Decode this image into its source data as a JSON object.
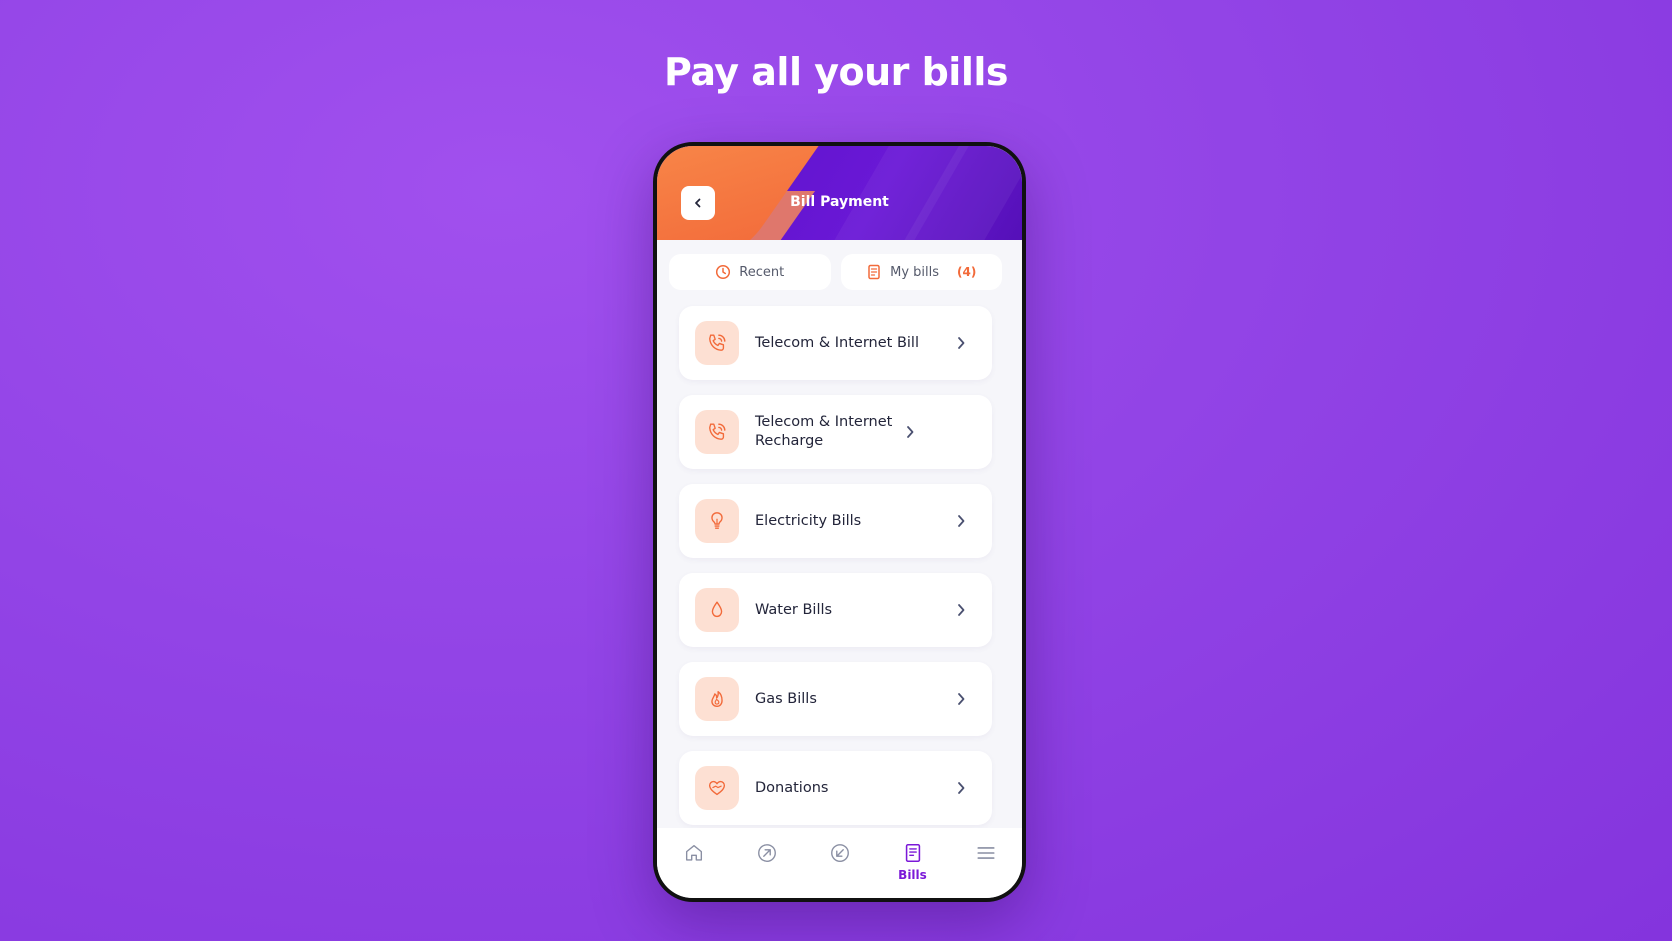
{
  "headline": "Pay all your bills",
  "header": {
    "title": "Bill Payment"
  },
  "tabs": [
    {
      "label": "Recent",
      "icon": "clock-icon"
    },
    {
      "label": "My bills",
      "count": "(4)",
      "icon": "receipt-icon"
    }
  ],
  "items": [
    {
      "label": "Telecom & Internet Bill",
      "icon": "phone-icon"
    },
    {
      "label": "Telecom & Internet Recharge",
      "icon": "phone-icon"
    },
    {
      "label": "Electricity Bills",
      "icon": "lightbulb-icon"
    },
    {
      "label": "Water Bills",
      "icon": "water-drop-icon"
    },
    {
      "label": "Gas Bills",
      "icon": "flame-icon"
    },
    {
      "label": "Donations",
      "icon": "heart-hand-icon"
    }
  ],
  "nav": [
    {
      "icon": "home-icon",
      "label": ""
    },
    {
      "icon": "send-icon",
      "label": ""
    },
    {
      "icon": "receive-icon",
      "label": ""
    },
    {
      "icon": "bills-icon",
      "label": "Bills",
      "active": true
    },
    {
      "icon": "menu-icon",
      "label": ""
    }
  ],
  "colors": {
    "accent": "#f26a3a",
    "brand": "#6a18d6",
    "background": "#9244e6"
  }
}
